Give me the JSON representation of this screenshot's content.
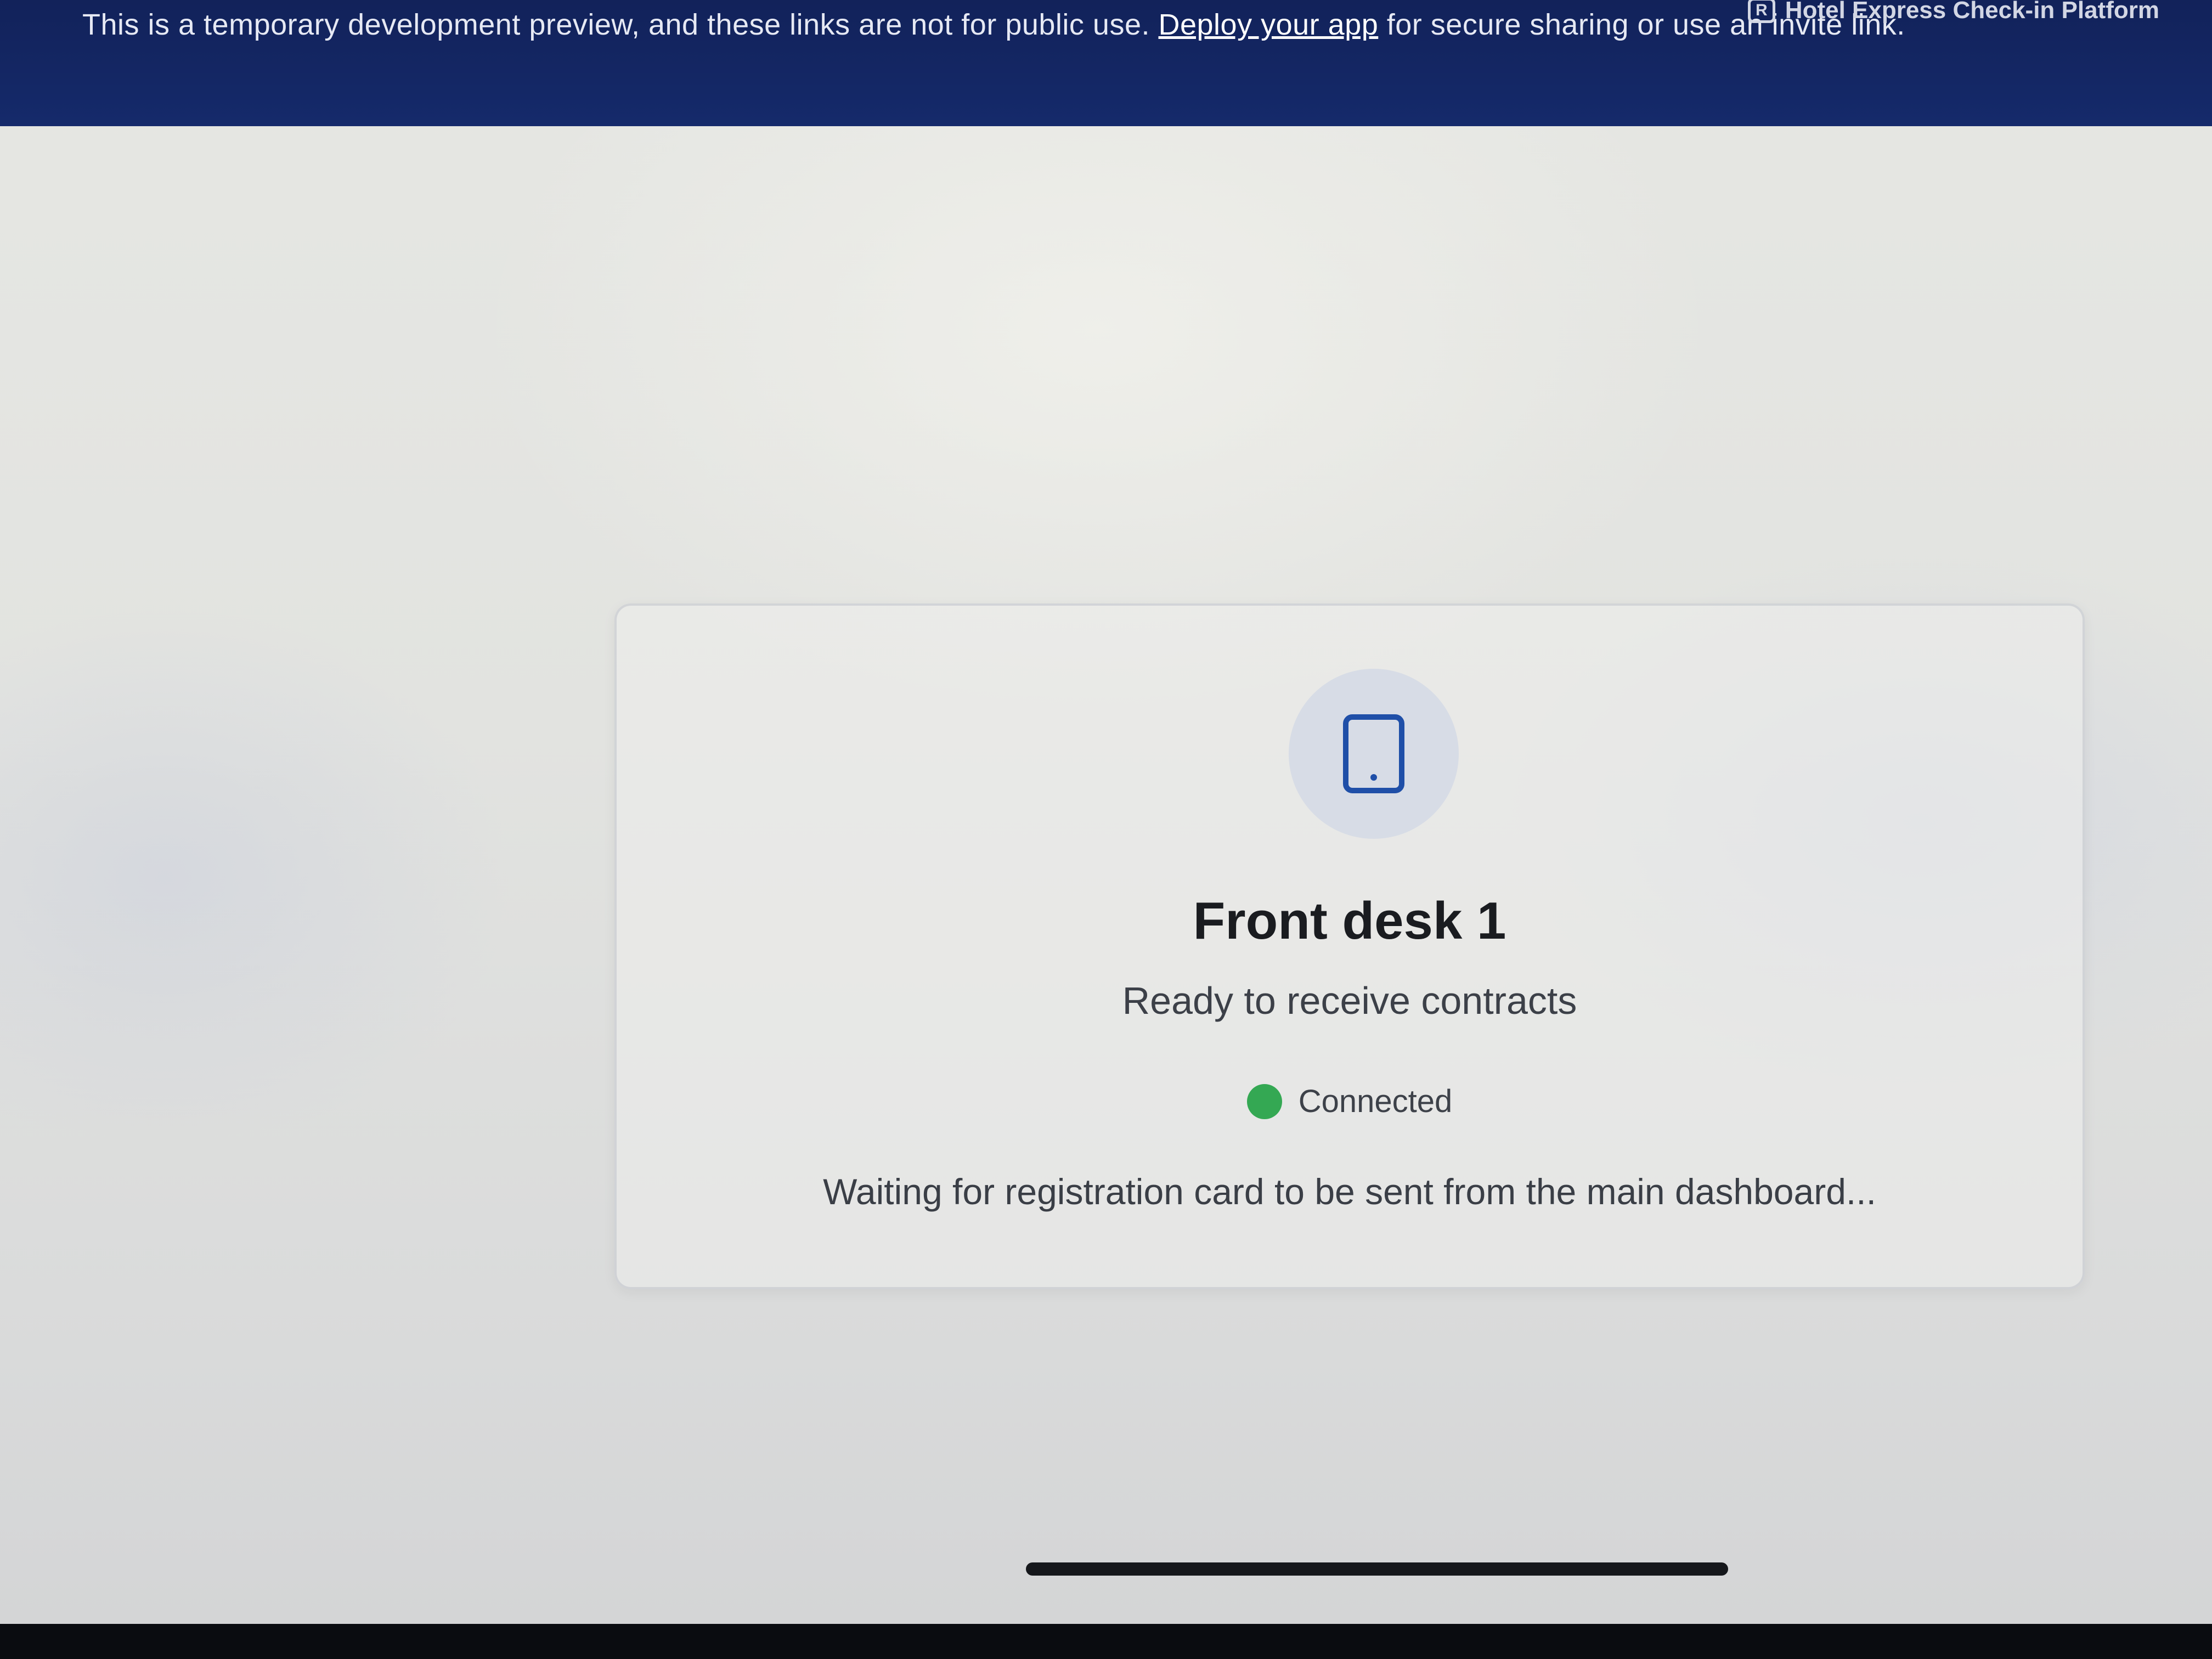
{
  "banner": {
    "text_prefix": "This is a temporary development preview, and these links are not for public use.",
    "link_label": "Deploy your app",
    "text_suffix": "for secure sharing or use an invite link.",
    "brand_icon": "R",
    "brand_name": "Hotel Express Check-in Platform"
  },
  "device_card": {
    "icon": "tablet-icon",
    "title": "Front desk 1",
    "subtitle": "Ready to receive contracts",
    "status": {
      "label": "Connected",
      "color": "#34a853"
    },
    "waiting_message": "Waiting for registration card to be sent from the main dashboard..."
  },
  "colors": {
    "banner_background": "#152a6b",
    "accent": "#1f4fa8",
    "status_connected": "#34a853"
  }
}
